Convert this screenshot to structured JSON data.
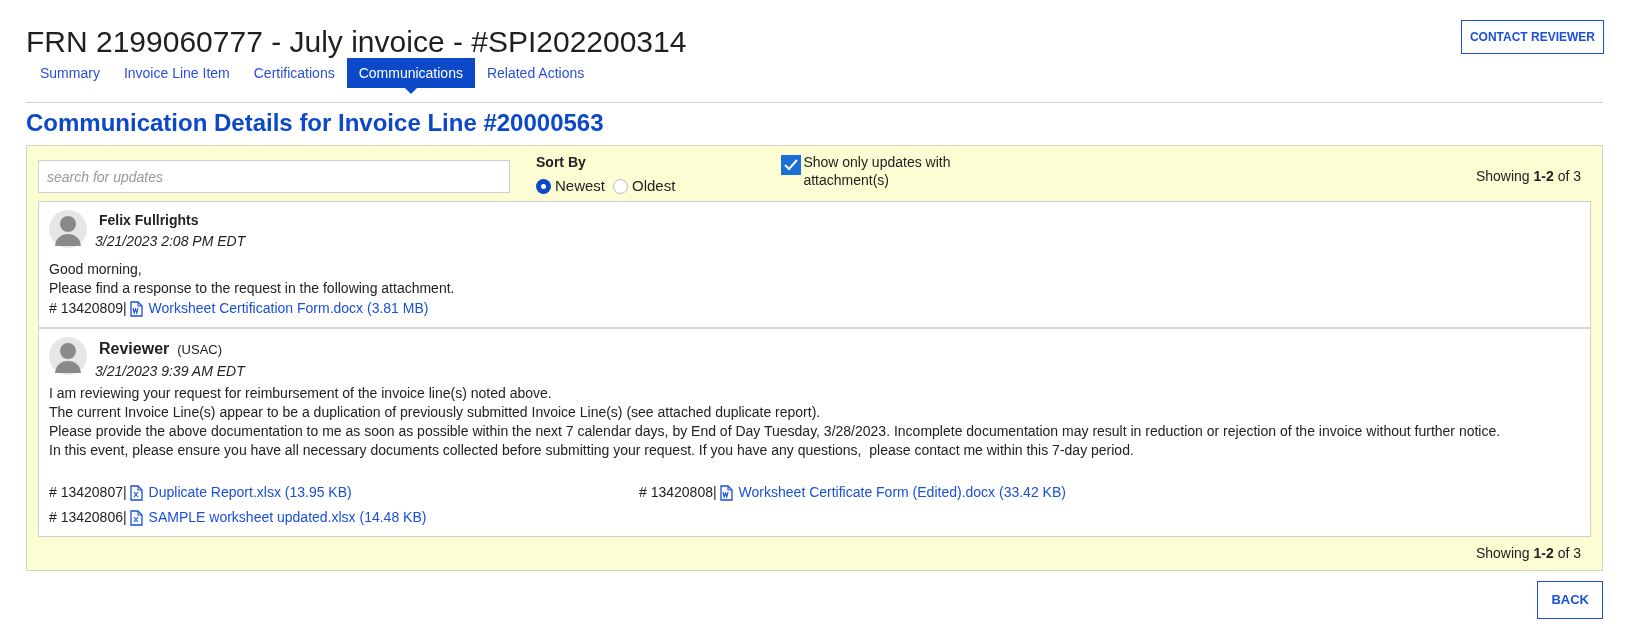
{
  "page": {
    "title": "FRN 2199060777 - July invoice - #SPI202200314",
    "contact_button": "CONTACT REVIEWER"
  },
  "tabs": [
    {
      "label": "Summary",
      "selected": false
    },
    {
      "label": "Invoice Line Item",
      "selected": false
    },
    {
      "label": "Certifications",
      "selected": false
    },
    {
      "label": "Communications",
      "selected": true
    },
    {
      "label": "Related Actions",
      "selected": false
    }
  ],
  "heading": "Communication Details for Invoice Line #20000563",
  "filters": {
    "search": {
      "placeholder": "search for updates"
    },
    "sort_label": "Sort By",
    "sort_options": [
      {
        "label": "Newest",
        "selected": true
      },
      {
        "label": "Oldest",
        "selected": false
      }
    ],
    "attachments_only": {
      "label": "Show only updates with attachment(s)",
      "checked": true
    },
    "showing": "Showing **1-2** of 3"
  },
  "messages": [
    {
      "author": "Felix Fullrights",
      "date": "3/21/2023 2:08 PM EDT",
      "lines": [
        "Good morning,",
        "Please find a response to the request in the following attachment."
      ],
      "attachments": [
        {
          "number": "# 13420809|",
          "kind": "word",
          "file": "Worksheet Certification Form.docx (3.81 MB)"
        }
      ]
    },
    {
      "author": "Reviewer",
      "org": "(USAC)",
      "date": "3/21/2023 9:39 AM EDT",
      "lines": [
        "I am reviewing your request for reimbursement of the invoice line(s) noted above.",
        "The current Invoice Line(s) appear to be a duplication of previously submitted Invoice Line(s) (see attached duplicate report).",
        "Please provide the above documentation to me as soon as possible within the next 7 calendar days, by End of Day Tuesday, 3/28/2023. Incomplete documentation may result in reduction or rejection of the invoice without further notice.",
        "In this event, please ensure you have all necessary documents collected before submitting your request. If you have any questions,  please contact me within this 7-day period."
      ],
      "attachments": [
        {
          "number": "# 13420807|",
          "kind": "excel",
          "file": "Duplicate Report.xlsx (13.95 KB)"
        },
        {
          "number": "# 13420808|",
          "kind": "word",
          "file": "Worksheet Certificate Form (Edited).docx (33.42 KB)"
        },
        {
          "number": "# 13420806|",
          "kind": "excel",
          "file": "SAMPLE worksheet updated.xlsx (14.48 KB)"
        }
      ]
    }
  ],
  "footer": {
    "showing": "Showing **1-2** of 3",
    "back_button": "BACK"
  }
}
